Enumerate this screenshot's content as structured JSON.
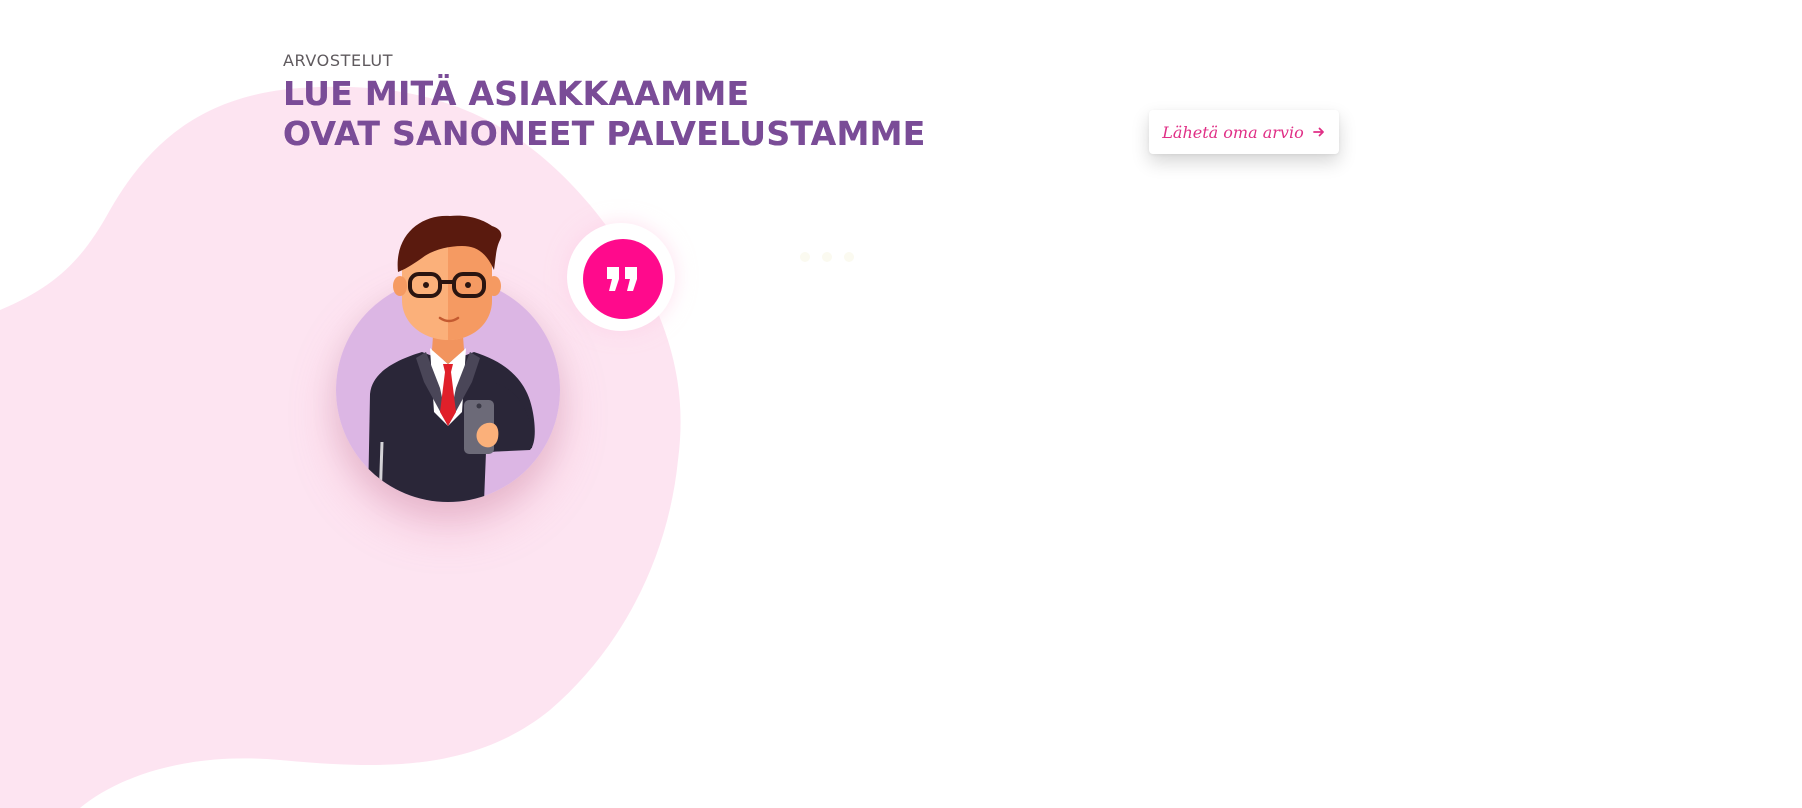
{
  "section": {
    "eyebrow": "ARVOSTELUT",
    "heading_line_1": "LUE MITÄ ASIAKKAAMME",
    "heading_line_2": "OVAT SANONEET PALVELUSTAMME"
  },
  "send_review_button": {
    "label": "Lähetä oma arvio",
    "icon": "arrow-right-icon"
  },
  "testimonial": {
    "avatar": "businessman-avatar",
    "quote_icon": "quote-icon"
  },
  "colors": {
    "accent_pink": "#ff0a8c",
    "heading_purple": "#7a4c97",
    "blob_pink": "#fde4f1",
    "avatar_lilac": "#dcb6e4"
  }
}
